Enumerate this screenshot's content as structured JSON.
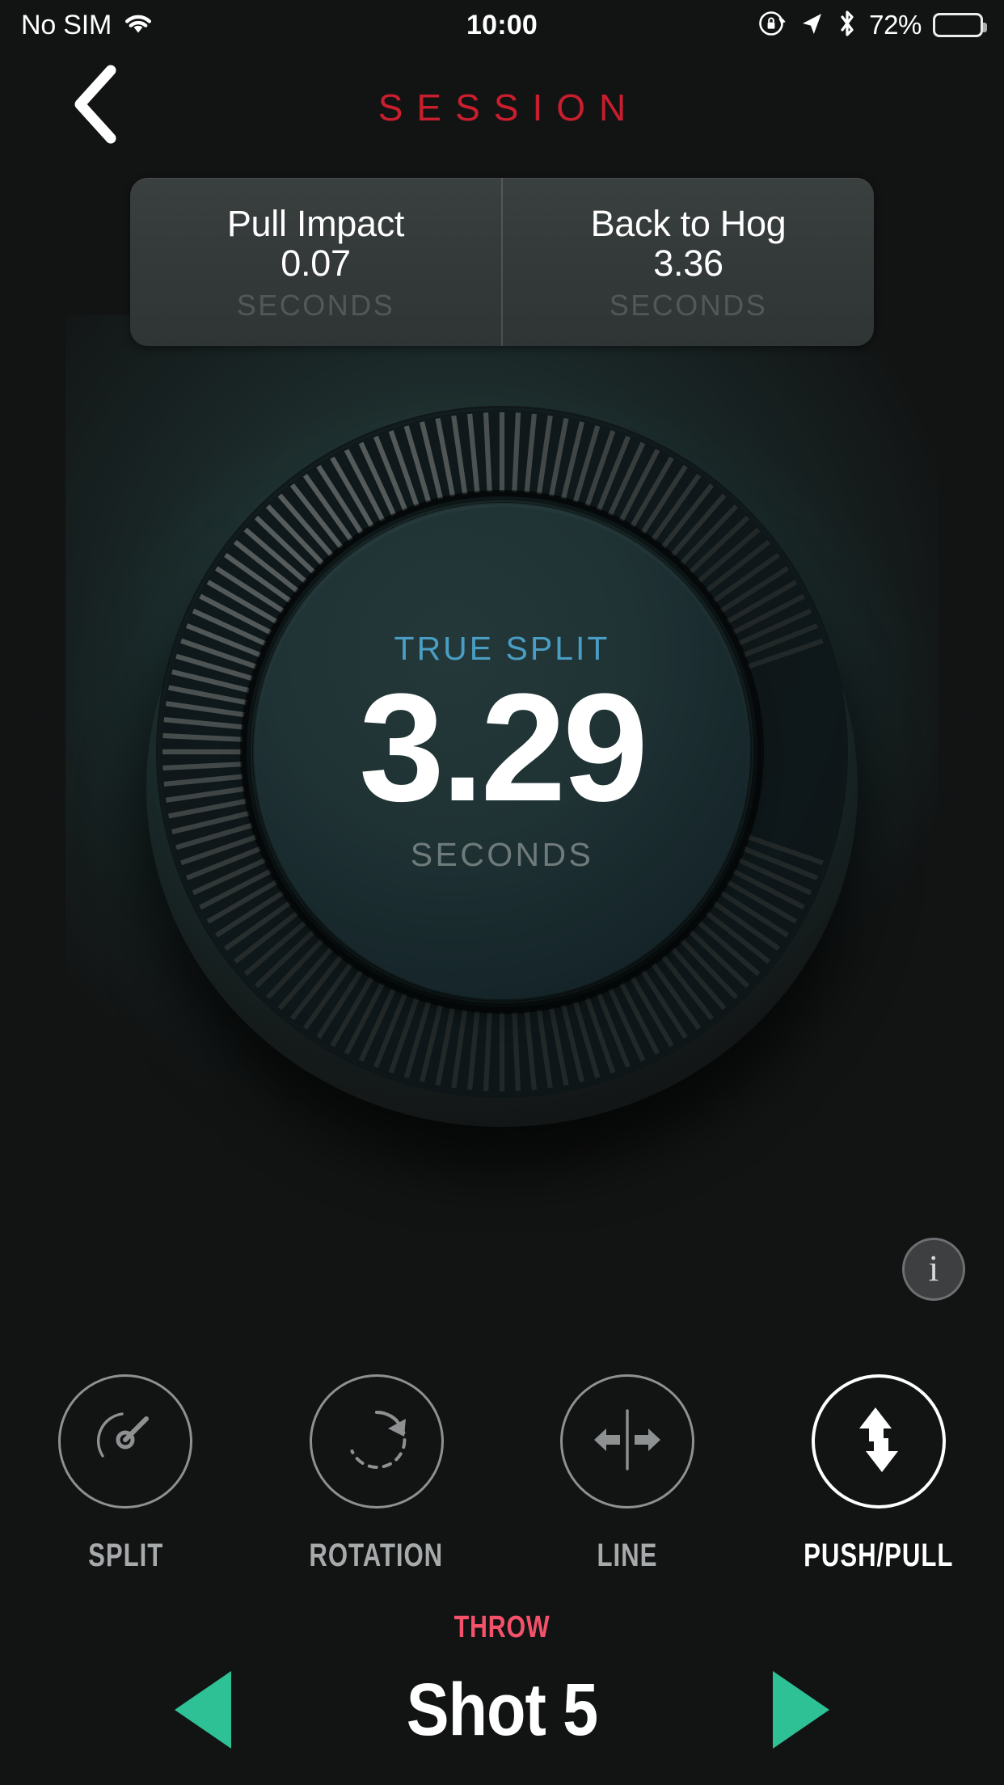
{
  "statusbar": {
    "carrier": "No SIM",
    "wifi_icon": "wifi-icon",
    "time": "10:00",
    "rotation_lock_icon": "rotation-lock-icon",
    "location_icon": "location-arrow-icon",
    "bluetooth_icon": "bluetooth-icon",
    "battery_percent": "72%",
    "battery_level": 72
  },
  "header": {
    "back_icon": "chevron-left-icon",
    "title": "SESSION",
    "title_color": "#c91e2d"
  },
  "stats": [
    {
      "label": "Pull Impact",
      "value": "0.07",
      "unit": "SECONDS"
    },
    {
      "label": "Back to Hog",
      "value": "3.36",
      "unit": "SECONDS"
    }
  ],
  "dial": {
    "metric_label": "TRUE SPLIT",
    "metric_label_color": "#4a9ec4",
    "value": "3.29",
    "unit": "SECONDS",
    "face_color": "#1f3234"
  },
  "info_button": {
    "icon": "info-icon",
    "glyph": "i"
  },
  "tabs": [
    {
      "label": "SPLIT",
      "icon": "gauge-icon",
      "active": false
    },
    {
      "label": "ROTATION",
      "icon": "rotation-icon",
      "active": false
    },
    {
      "label": "LINE",
      "icon": "left-right-arrows-icon",
      "active": false
    },
    {
      "label": "PUSH/PULL",
      "icon": "up-down-arrows-icon",
      "active": true
    }
  ],
  "bottom_nav": {
    "section_label": "THROW",
    "section_label_color": "#f4526b",
    "prev_icon": "triangle-left-icon",
    "shot_title": "Shot 5",
    "next_icon": "triangle-right-icon",
    "arrow_color": "#2ec196"
  }
}
